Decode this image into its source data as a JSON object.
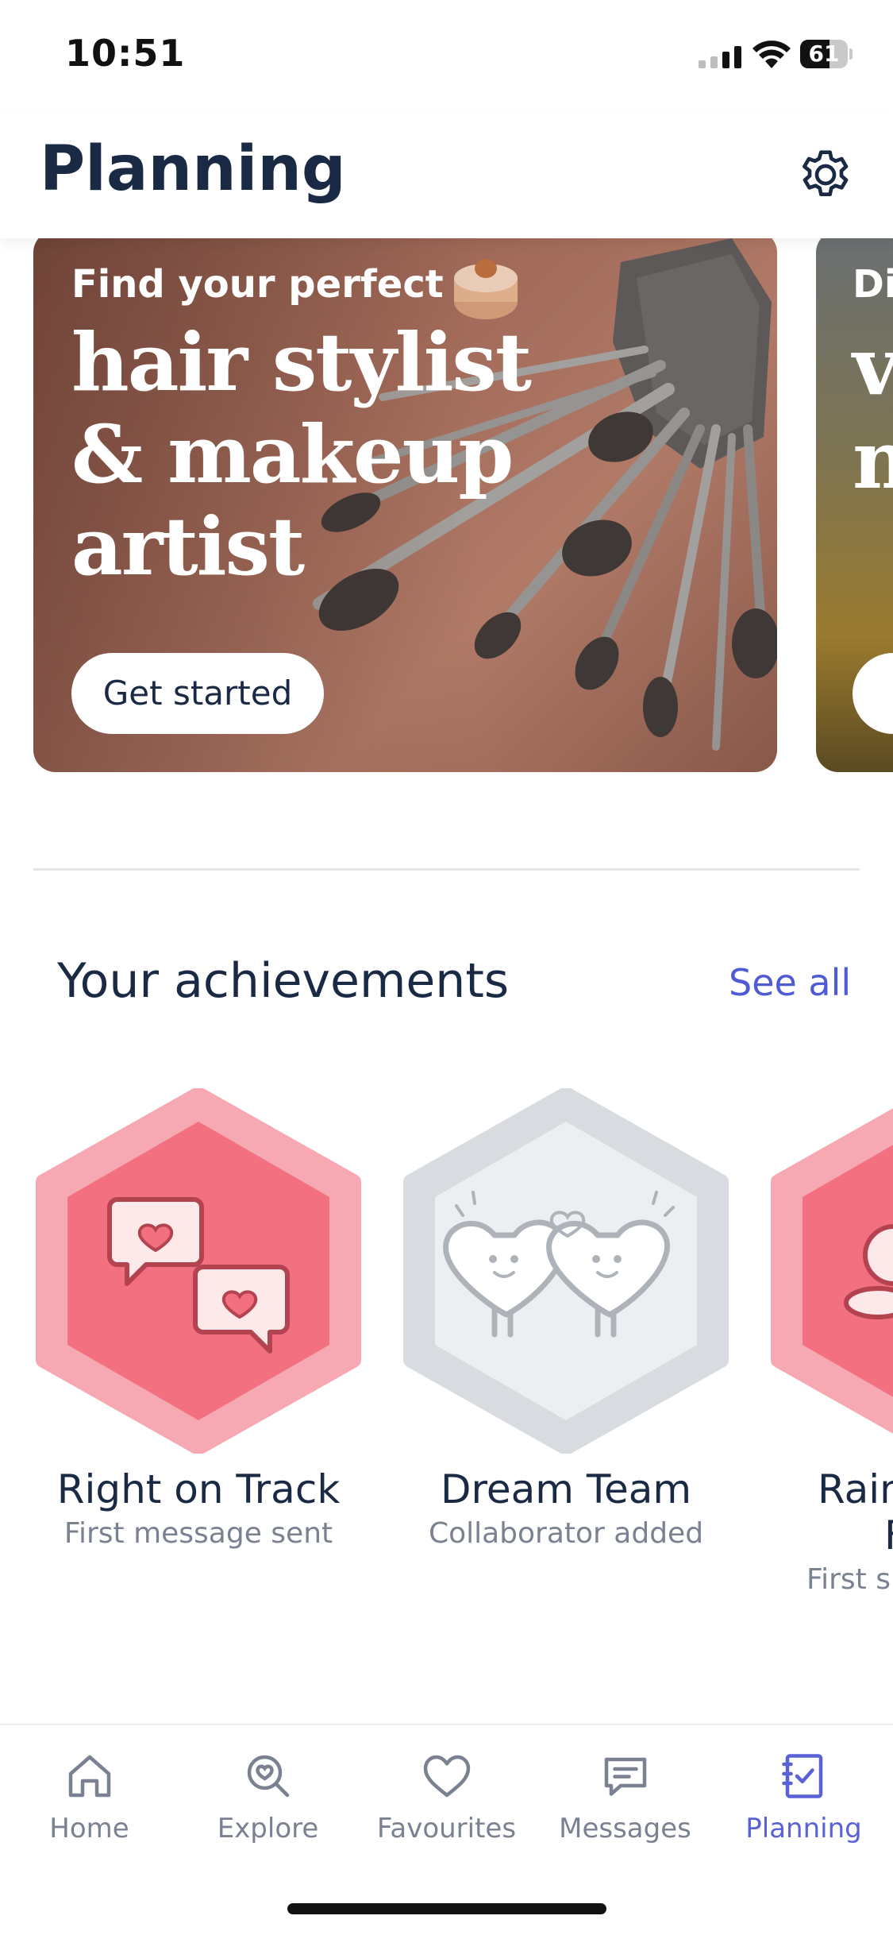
{
  "status_bar": {
    "time": "10:51",
    "battery": "61",
    "battery_level": 0.61
  },
  "header": {
    "title": "Planning",
    "settings_icon": "gear-icon"
  },
  "promo_cards": [
    {
      "kicker": "Find your perfect",
      "headline_line1": "hair stylist",
      "headline_line2": "& makeup",
      "headline_line3": "artist",
      "button": "Get started"
    },
    {
      "kicker": "Di",
      "headline": "v\nn"
    }
  ],
  "achievements": {
    "title": "Your achievements",
    "see_all": "See all",
    "items": [
      {
        "title": "Right on Track",
        "subtitle": "First message sent",
        "state": "earned"
      },
      {
        "title": "Dream Team",
        "subtitle": "Collaborator added",
        "state": "locked"
      },
      {
        "title": "Rain",
        "title_line2": "F",
        "subtitle": "First su",
        "state": "earned"
      }
    ]
  },
  "tabs": [
    {
      "label": "Home",
      "icon": "home-icon"
    },
    {
      "label": "Explore",
      "icon": "explore-icon"
    },
    {
      "label": "Favourites",
      "icon": "heart-icon"
    },
    {
      "label": "Messages",
      "icon": "messages-icon"
    },
    {
      "label": "Planning",
      "icon": "planning-icon",
      "active": true
    }
  ],
  "colors": {
    "accent": "#5b62d8",
    "title": "#1a2a45",
    "badge_pink": "#f2707f",
    "badge_pink_light": "#f6a9b3",
    "badge_grey": "#eceef1"
  }
}
